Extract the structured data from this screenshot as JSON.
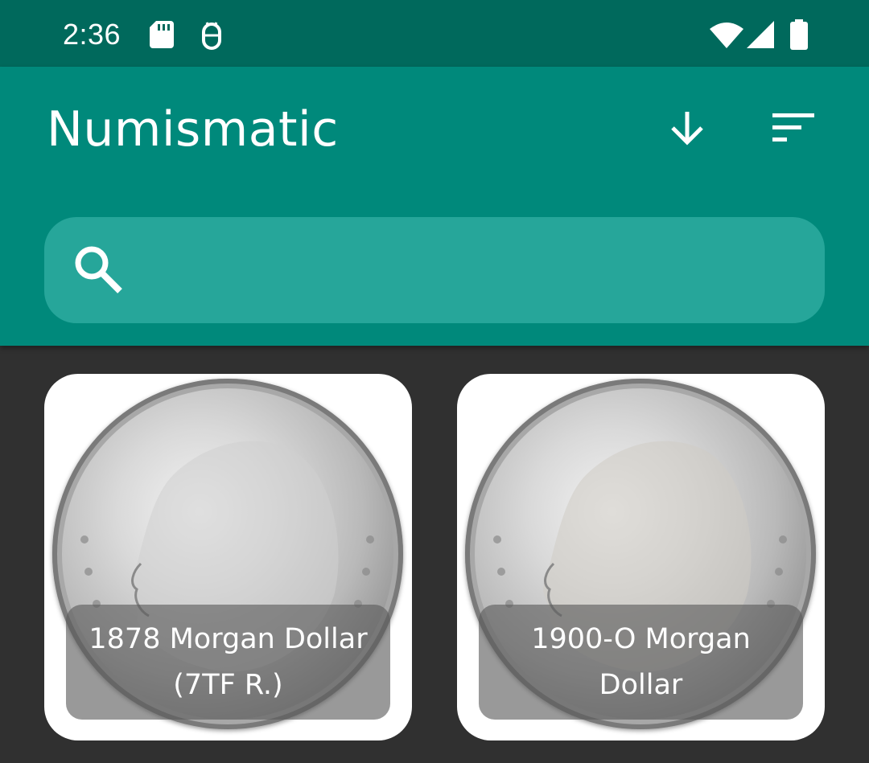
{
  "status_bar": {
    "time": "2:36",
    "left_icons": [
      "sd-card-icon",
      "android-debug-icon"
    ],
    "right_icons": [
      "wifi-icon",
      "cell-signal-icon",
      "battery-icon"
    ]
  },
  "app_bar": {
    "title": "Numismatic",
    "actions": [
      "download-arrow-icon",
      "sort-icon"
    ],
    "accent_color": "#00897b",
    "status_color": "#00695c"
  },
  "search": {
    "placeholder": "",
    "value": ""
  },
  "coins": [
    {
      "name": "1878 Morgan Dollar (7TF R.)"
    },
    {
      "name": "1900-O Morgan Dollar"
    }
  ]
}
